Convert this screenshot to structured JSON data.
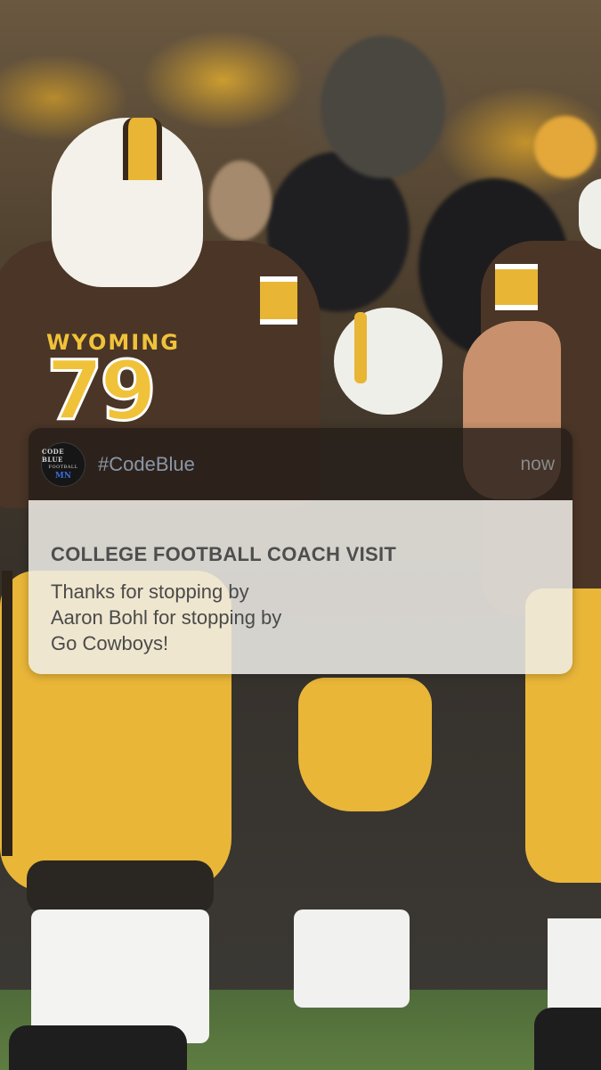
{
  "notification": {
    "app_name": "#CodeBlue",
    "time": "now",
    "app_icon": {
      "name": "code-blue-football-logo",
      "line1": "CODE BLUE",
      "line2": "FOOTBALL",
      "line3": "MN"
    },
    "title": "COLLEGE FOOTBALL COACH VISIT",
    "body_lines": [
      "Thanks for stopping by",
      "Aaron Bohl for stopping by",
      "Go Cowboys!"
    ]
  },
  "background": {
    "jersey_number": "79",
    "jersey_wordmark": "WYOMING"
  },
  "colors": {
    "gold": "#e9b638",
    "brown": "#4a3526",
    "app_name_color": "#8b96a8"
  }
}
